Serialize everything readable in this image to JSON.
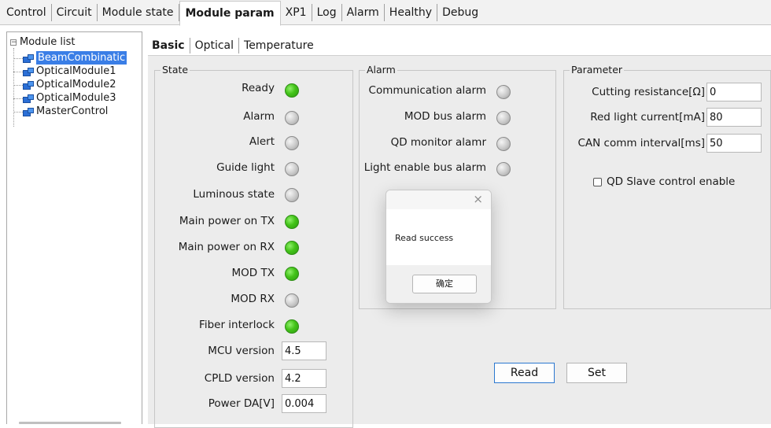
{
  "top_tabs": [
    "Control",
    "Circuit",
    "Module state",
    "Module param",
    "XP1",
    "Log",
    "Alarm",
    "Healthy",
    "Debug"
  ],
  "active_top_tab": "Module param",
  "tree": {
    "root": "Module list",
    "items": [
      "BeamCombinatic",
      "OpticalModule1",
      "OpticalModule2",
      "OpticalModule3",
      "MasterControl"
    ],
    "selected": "BeamCombinatic"
  },
  "sub_tabs": [
    "Basic",
    "Optical",
    "Temperature"
  ],
  "active_sub_tab": "Basic",
  "state": {
    "title": "State",
    "indicators": [
      {
        "label": "Ready",
        "status": "green"
      },
      {
        "label": "Alarm",
        "status": "grey"
      },
      {
        "label": "Alert",
        "status": "grey"
      },
      {
        "label": "Guide light",
        "status": "grey"
      },
      {
        "label": "Luminous state",
        "status": "grey"
      },
      {
        "label": "Main power on TX",
        "status": "green"
      },
      {
        "label": "Main power on RX",
        "status": "green"
      },
      {
        "label": "MOD TX",
        "status": "green"
      },
      {
        "label": "MOD RX",
        "status": "grey"
      },
      {
        "label": "Fiber interlock",
        "status": "green"
      }
    ],
    "values": [
      {
        "label": "MCU version",
        "value": "4.5"
      },
      {
        "label": "CPLD version",
        "value": "4.2"
      },
      {
        "label": "Power DA[V]",
        "value": "0.004"
      }
    ]
  },
  "alarm": {
    "title": "Alarm",
    "indicators": [
      {
        "label": "Communication alarm",
        "status": "grey"
      },
      {
        "label": "MOD bus alarm",
        "status": "grey"
      },
      {
        "label": "QD monitor alamr",
        "status": "grey"
      },
      {
        "label": "Light enable bus alarm",
        "status": "grey"
      }
    ]
  },
  "parameter": {
    "title": "Parameter",
    "fields": [
      {
        "label": "Cutting resistance[Ω]",
        "value": "0"
      },
      {
        "label": "Red light current[mA]",
        "value": "80"
      },
      {
        "label": "CAN comm interval[ms]",
        "value": "50"
      }
    ],
    "checkbox_label": "QD Slave control enable",
    "checkbox_checked": false
  },
  "buttons": {
    "read": "Read",
    "set": "Set"
  },
  "dialog": {
    "close": "×",
    "message": "Read success",
    "ok": "确定"
  }
}
